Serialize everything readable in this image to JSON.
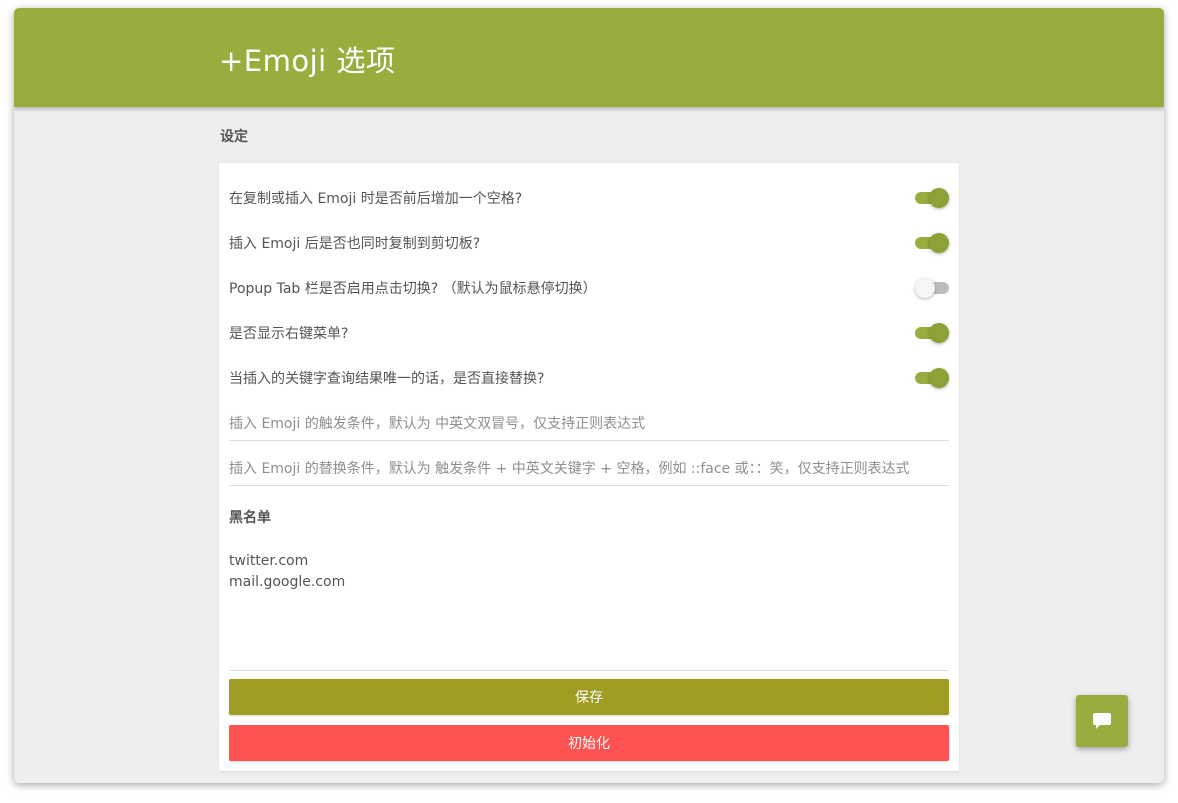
{
  "header": {
    "title": "+Emoji 选项"
  },
  "section": {
    "title": "设定"
  },
  "colors": {
    "accent": "#97ae3f",
    "save": "#9e9c22",
    "reset": "#ff5252"
  },
  "settings": [
    {
      "label": "在复制或插入 Emoji 时是否前后增加一个空格?",
      "on": true
    },
    {
      "label": "插入 Emoji 后是否也同时复制到剪切板?",
      "on": true
    },
    {
      "label": "Popup Tab 栏是否启用点击切换? （默认为鼠标悬停切换）",
      "on": false
    },
    {
      "label": "是否显示右键菜单?",
      "on": true
    },
    {
      "label": "当插入的关键字查询结果唯一的话，是否直接替换?",
      "on": true
    }
  ],
  "inputs": {
    "trigger_placeholder": "插入 Emoji 的触发条件，默认为 中英文双冒号，仅支持正则表达式",
    "replace_placeholder": "插入 Emoji 的替换条件，默认为 触发条件 + 中英文关键字 + 空格，例如 ::face 或：：笑，仅支持正则表达式"
  },
  "blacklist": {
    "title": "黑名单",
    "value": "twitter.com\nmail.google.com"
  },
  "buttons": {
    "save": "保存",
    "reset": "初始化"
  },
  "fab": {
    "icon": "chat-icon"
  }
}
